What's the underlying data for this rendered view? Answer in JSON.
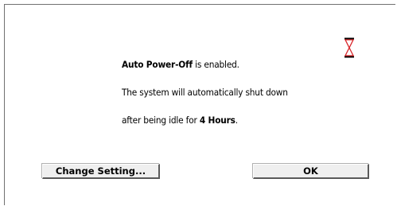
{
  "dialog": {
    "message": {
      "line1_bold": "Auto Power-Off",
      "line1_rest": " is enabled.",
      "line2": "The system will automatically shut down",
      "line3_prefix": "after being idle for ",
      "line3_bold": "4 Hours",
      "line3_suffix": "."
    },
    "icon": "hourglass-icon",
    "buttons": {
      "change_setting": "Change Setting...",
      "ok": "OK"
    }
  },
  "colors": {
    "hourglass_sand": "#d8262a",
    "button_face": "#efefef"
  }
}
